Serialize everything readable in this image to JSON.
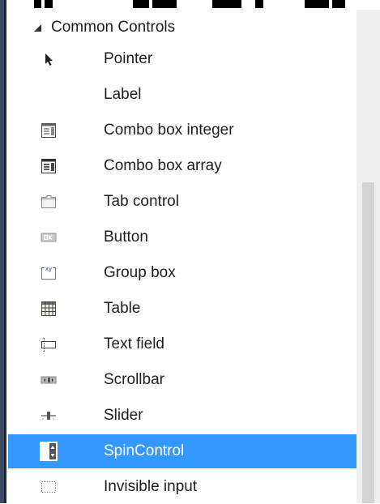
{
  "toolbox": {
    "group": {
      "title": "Common Controls",
      "expanded": true
    },
    "items": [
      {
        "label": "Pointer",
        "icon": "pointer-icon"
      },
      {
        "label": "Label",
        "icon": ""
      },
      {
        "label": "Combo box integer",
        "icon": "combo-box-integer-icon"
      },
      {
        "label": "Combo box array",
        "icon": "combo-box-array-icon"
      },
      {
        "label": "Tab control",
        "icon": "tab-control-icon"
      },
      {
        "label": "Button",
        "icon": "button-icon"
      },
      {
        "label": "Group box",
        "icon": "group-box-icon"
      },
      {
        "label": "Table",
        "icon": "table-icon"
      },
      {
        "label": "Text field",
        "icon": "text-field-icon"
      },
      {
        "label": "Scrollbar",
        "icon": "scrollbar-icon"
      },
      {
        "label": "Slider",
        "icon": "slider-icon"
      },
      {
        "label": "SpinControl",
        "icon": "spin-control-icon",
        "selected": true
      },
      {
        "label": "Invisible input",
        "icon": "invisible-input-icon"
      }
    ],
    "colors": {
      "selection": "#3399ff",
      "frame_border": "#3f4a63",
      "scrollbar_track": "#f0f0f0",
      "scrollbar_thumb": "#d4d4d4"
    }
  }
}
